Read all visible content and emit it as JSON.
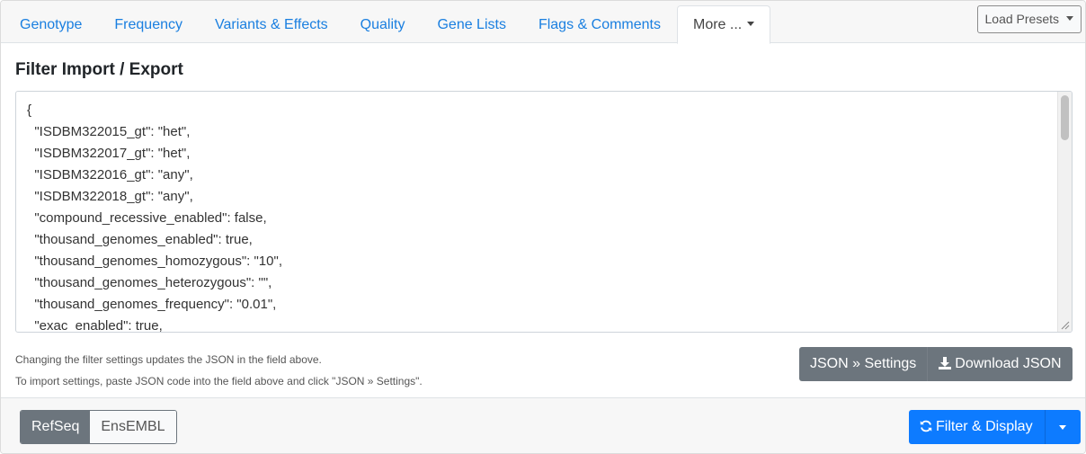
{
  "tabs": [
    {
      "label": "Genotype"
    },
    {
      "label": "Frequency"
    },
    {
      "label": "Variants & Effects"
    },
    {
      "label": "Quality"
    },
    {
      "label": "Gene Lists"
    },
    {
      "label": "Flags & Comments"
    },
    {
      "label": "More ..."
    }
  ],
  "header": {
    "load_presets_label": "Load Presets"
  },
  "section": {
    "title": "Filter Import / Export"
  },
  "json_field": {
    "lines": [
      "{",
      "  \"ISDBM322015_gt\": \"het\",",
      "  \"ISDBM322017_gt\": \"het\",",
      "  \"ISDBM322016_gt\": \"any\",",
      "  \"ISDBM322018_gt\": \"any\",",
      "  \"compound_recessive_enabled\": false,",
      "  \"thousand_genomes_enabled\": true,",
      "  \"thousand_genomes_homozygous\": \"10\",",
      "  \"thousand_genomes_heterozygous\": \"\",",
      "  \"thousand_genomes_frequency\": \"0.01\",",
      "  \"exac_enabled\": true,"
    ]
  },
  "hints": {
    "line1": "Changing the filter settings updates the JSON in the field above.",
    "line2": "To import settings, paste JSON code into the field above and click \"JSON » Settings\"."
  },
  "json_buttons": {
    "to_settings": "JSON » Settings",
    "download": "Download JSON"
  },
  "footer": {
    "refseq_label": "RefSeq",
    "ensembl_label": "EnsEMBL",
    "filter_display_label": "Filter & Display"
  },
  "colors": {
    "primary": "#0d7bff",
    "secondary": "#6c757d",
    "link": "#1a7fe0"
  }
}
